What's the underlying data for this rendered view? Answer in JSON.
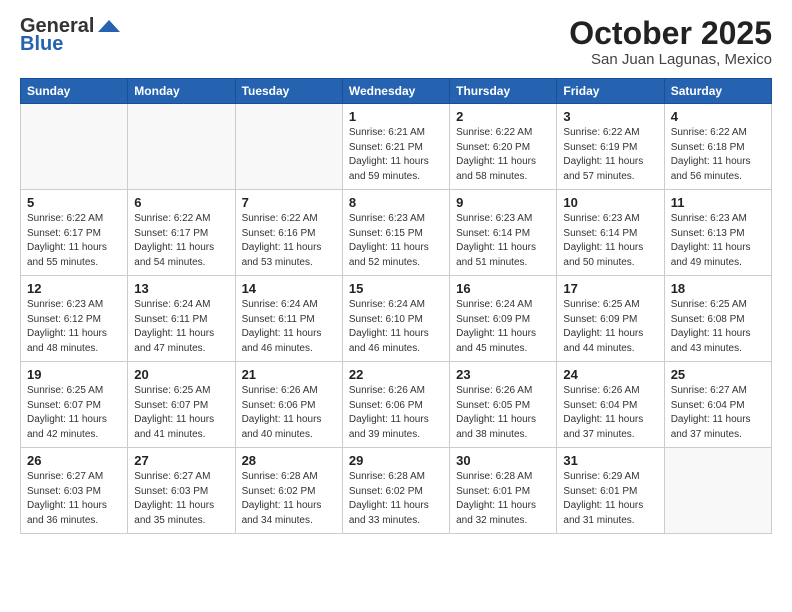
{
  "header": {
    "logo_general": "General",
    "logo_blue": "Blue",
    "month": "October 2025",
    "location": "San Juan Lagunas, Mexico"
  },
  "days_of_week": [
    "Sunday",
    "Monday",
    "Tuesday",
    "Wednesday",
    "Thursday",
    "Friday",
    "Saturday"
  ],
  "weeks": [
    [
      {
        "day": "",
        "sunrise": "",
        "sunset": "",
        "daylight": ""
      },
      {
        "day": "",
        "sunrise": "",
        "sunset": "",
        "daylight": ""
      },
      {
        "day": "",
        "sunrise": "",
        "sunset": "",
        "daylight": ""
      },
      {
        "day": "1",
        "sunrise": "Sunrise: 6:21 AM",
        "sunset": "Sunset: 6:21 PM",
        "daylight": "Daylight: 11 hours and 59 minutes."
      },
      {
        "day": "2",
        "sunrise": "Sunrise: 6:22 AM",
        "sunset": "Sunset: 6:20 PM",
        "daylight": "Daylight: 11 hours and 58 minutes."
      },
      {
        "day": "3",
        "sunrise": "Sunrise: 6:22 AM",
        "sunset": "Sunset: 6:19 PM",
        "daylight": "Daylight: 11 hours and 57 minutes."
      },
      {
        "day": "4",
        "sunrise": "Sunrise: 6:22 AM",
        "sunset": "Sunset: 6:18 PM",
        "daylight": "Daylight: 11 hours and 56 minutes."
      }
    ],
    [
      {
        "day": "5",
        "sunrise": "Sunrise: 6:22 AM",
        "sunset": "Sunset: 6:17 PM",
        "daylight": "Daylight: 11 hours and 55 minutes."
      },
      {
        "day": "6",
        "sunrise": "Sunrise: 6:22 AM",
        "sunset": "Sunset: 6:17 PM",
        "daylight": "Daylight: 11 hours and 54 minutes."
      },
      {
        "day": "7",
        "sunrise": "Sunrise: 6:22 AM",
        "sunset": "Sunset: 6:16 PM",
        "daylight": "Daylight: 11 hours and 53 minutes."
      },
      {
        "day": "8",
        "sunrise": "Sunrise: 6:23 AM",
        "sunset": "Sunset: 6:15 PM",
        "daylight": "Daylight: 11 hours and 52 minutes."
      },
      {
        "day": "9",
        "sunrise": "Sunrise: 6:23 AM",
        "sunset": "Sunset: 6:14 PM",
        "daylight": "Daylight: 11 hours and 51 minutes."
      },
      {
        "day": "10",
        "sunrise": "Sunrise: 6:23 AM",
        "sunset": "Sunset: 6:14 PM",
        "daylight": "Daylight: 11 hours and 50 minutes."
      },
      {
        "day": "11",
        "sunrise": "Sunrise: 6:23 AM",
        "sunset": "Sunset: 6:13 PM",
        "daylight": "Daylight: 11 hours and 49 minutes."
      }
    ],
    [
      {
        "day": "12",
        "sunrise": "Sunrise: 6:23 AM",
        "sunset": "Sunset: 6:12 PM",
        "daylight": "Daylight: 11 hours and 48 minutes."
      },
      {
        "day": "13",
        "sunrise": "Sunrise: 6:24 AM",
        "sunset": "Sunset: 6:11 PM",
        "daylight": "Daylight: 11 hours and 47 minutes."
      },
      {
        "day": "14",
        "sunrise": "Sunrise: 6:24 AM",
        "sunset": "Sunset: 6:11 PM",
        "daylight": "Daylight: 11 hours and 46 minutes."
      },
      {
        "day": "15",
        "sunrise": "Sunrise: 6:24 AM",
        "sunset": "Sunset: 6:10 PM",
        "daylight": "Daylight: 11 hours and 46 minutes."
      },
      {
        "day": "16",
        "sunrise": "Sunrise: 6:24 AM",
        "sunset": "Sunset: 6:09 PM",
        "daylight": "Daylight: 11 hours and 45 minutes."
      },
      {
        "day": "17",
        "sunrise": "Sunrise: 6:25 AM",
        "sunset": "Sunset: 6:09 PM",
        "daylight": "Daylight: 11 hours and 44 minutes."
      },
      {
        "day": "18",
        "sunrise": "Sunrise: 6:25 AM",
        "sunset": "Sunset: 6:08 PM",
        "daylight": "Daylight: 11 hours and 43 minutes."
      }
    ],
    [
      {
        "day": "19",
        "sunrise": "Sunrise: 6:25 AM",
        "sunset": "Sunset: 6:07 PM",
        "daylight": "Daylight: 11 hours and 42 minutes."
      },
      {
        "day": "20",
        "sunrise": "Sunrise: 6:25 AM",
        "sunset": "Sunset: 6:07 PM",
        "daylight": "Daylight: 11 hours and 41 minutes."
      },
      {
        "day": "21",
        "sunrise": "Sunrise: 6:26 AM",
        "sunset": "Sunset: 6:06 PM",
        "daylight": "Daylight: 11 hours and 40 minutes."
      },
      {
        "day": "22",
        "sunrise": "Sunrise: 6:26 AM",
        "sunset": "Sunset: 6:06 PM",
        "daylight": "Daylight: 11 hours and 39 minutes."
      },
      {
        "day": "23",
        "sunrise": "Sunrise: 6:26 AM",
        "sunset": "Sunset: 6:05 PM",
        "daylight": "Daylight: 11 hours and 38 minutes."
      },
      {
        "day": "24",
        "sunrise": "Sunrise: 6:26 AM",
        "sunset": "Sunset: 6:04 PM",
        "daylight": "Daylight: 11 hours and 37 minutes."
      },
      {
        "day": "25",
        "sunrise": "Sunrise: 6:27 AM",
        "sunset": "Sunset: 6:04 PM",
        "daylight": "Daylight: 11 hours and 37 minutes."
      }
    ],
    [
      {
        "day": "26",
        "sunrise": "Sunrise: 6:27 AM",
        "sunset": "Sunset: 6:03 PM",
        "daylight": "Daylight: 11 hours and 36 minutes."
      },
      {
        "day": "27",
        "sunrise": "Sunrise: 6:27 AM",
        "sunset": "Sunset: 6:03 PM",
        "daylight": "Daylight: 11 hours and 35 minutes."
      },
      {
        "day": "28",
        "sunrise": "Sunrise: 6:28 AM",
        "sunset": "Sunset: 6:02 PM",
        "daylight": "Daylight: 11 hours and 34 minutes."
      },
      {
        "day": "29",
        "sunrise": "Sunrise: 6:28 AM",
        "sunset": "Sunset: 6:02 PM",
        "daylight": "Daylight: 11 hours and 33 minutes."
      },
      {
        "day": "30",
        "sunrise": "Sunrise: 6:28 AM",
        "sunset": "Sunset: 6:01 PM",
        "daylight": "Daylight: 11 hours and 32 minutes."
      },
      {
        "day": "31",
        "sunrise": "Sunrise: 6:29 AM",
        "sunset": "Sunset: 6:01 PM",
        "daylight": "Daylight: 11 hours and 31 minutes."
      },
      {
        "day": "",
        "sunrise": "",
        "sunset": "",
        "daylight": ""
      }
    ]
  ]
}
